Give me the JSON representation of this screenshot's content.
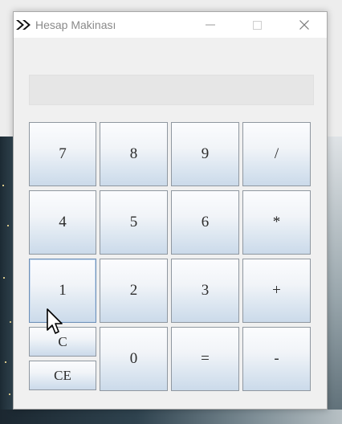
{
  "window": {
    "title": "Hesap Makinası"
  },
  "display": {
    "value": ""
  },
  "keys": {
    "k7": "7",
    "k8": "8",
    "k9": "9",
    "div": "/",
    "k4": "4",
    "k5": "5",
    "k6": "6",
    "mul": "*",
    "k1": "1",
    "k2": "2",
    "k3": "3",
    "add": "+",
    "clear": "C",
    "clear_entry": "CE",
    "k0": "0",
    "equals": "=",
    "sub": "-"
  },
  "icons": {
    "app": "double-chevron-right-icon",
    "minimize": "minimize-icon",
    "maximize": "maximize-icon",
    "close": "close-icon",
    "cursor": "mouse-pointer-icon"
  }
}
